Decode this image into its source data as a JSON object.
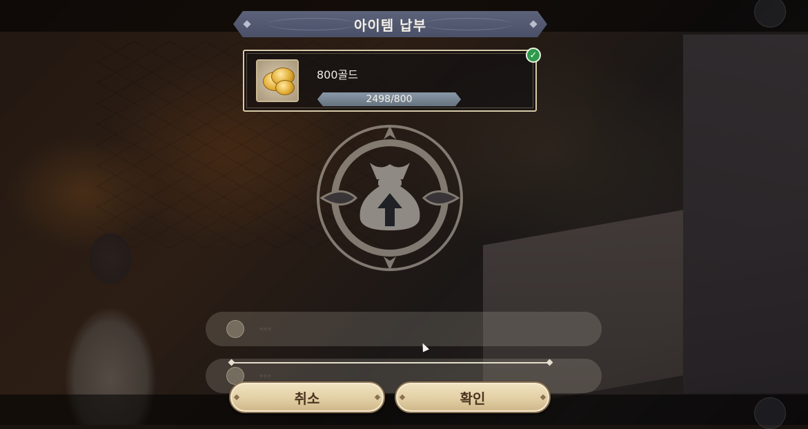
{
  "dialog": {
    "title": "아이템 납부",
    "item": {
      "name": "800골드",
      "icon": "gold-coins-icon",
      "progress_text": "2498/800",
      "owned": 2498,
      "required": 800,
      "fulfilled": true
    },
    "emblem_icon": "money-bag-upload-icon",
    "buttons": {
      "cancel": "취소",
      "confirm": "확인"
    }
  },
  "colors": {
    "banner": "#4a5068",
    "button": "#e2cfa4",
    "button_text": "#4a3420",
    "check": "#2e9a4c"
  }
}
